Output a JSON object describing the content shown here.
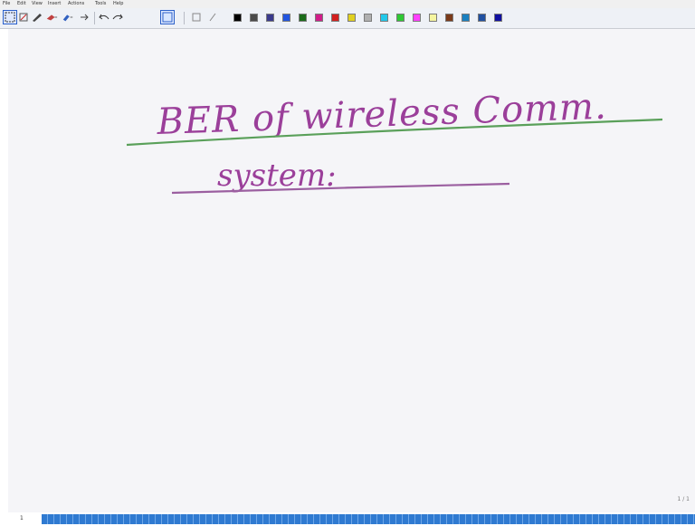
{
  "menu": [
    "File",
    "Edit",
    "View",
    "Insert",
    "Actions",
    "Tools",
    "Help"
  ],
  "palette": [
    "#000000",
    "#4a4a4a",
    "#3a3a8c",
    "#2255e0",
    "#1a6b1a",
    "#d01d8a",
    "#d22020",
    "#e0d020",
    "#b0b0b0",
    "#22c8ea",
    "#2ec834",
    "#ff40ff",
    "#f5f5a0",
    "#7a3a1a",
    "#1a80c0",
    "#2050a0",
    "#1010a0"
  ],
  "ink": {
    "line1": "BER of wireless Comm.",
    "line2": "system:",
    "ink_color": "#9b3f9a",
    "underline1_color": "#5aa05a",
    "underline2_color": "#9b5fa0"
  },
  "status": {
    "page": "1",
    "page_indicator": "1 / 1"
  }
}
